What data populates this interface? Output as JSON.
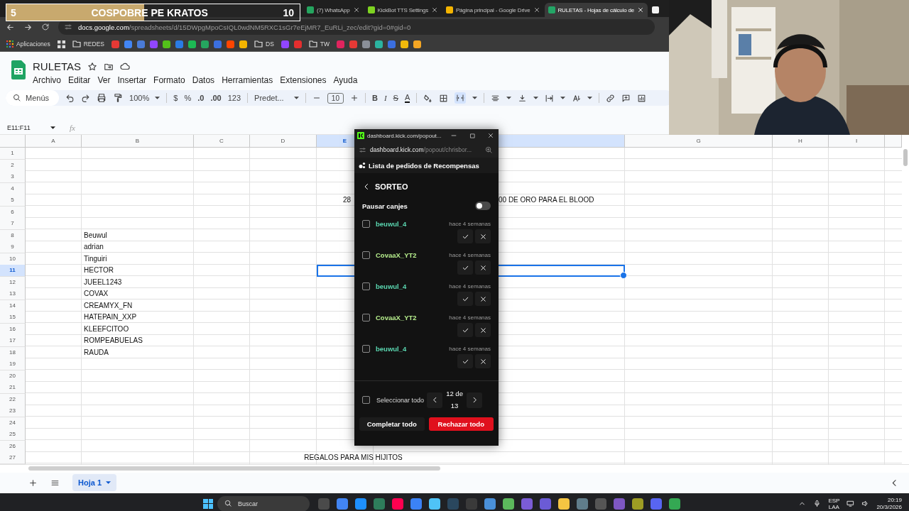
{
  "stream_overlay": {
    "start": "5",
    "title": "COSPOBRE PE KRATOS",
    "target": "10",
    "level": 0.47
  },
  "browser": {
    "tabs": [
      {
        "title": "(7) WhatsApp",
        "color": "#25a55f",
        "selected": false
      },
      {
        "title": "KickBot TTS Settings",
        "color": "#7ed321",
        "selected": false
      },
      {
        "title": "Página principal - Google Drive",
        "color": "#f4b400",
        "selected": false
      },
      {
        "title": "RULETAS - Hojas de cálculo de",
        "color": "#23a566",
        "selected": true
      },
      {
        "color": "#f2f2f2",
        "selected": false
      }
    ],
    "url_host": "docs.google.com",
    "url_path": "/spreadsheets/d/15DWpgMpoCsIQL0wdNM5RXC1sGr7eEjMR7_EuRLi_zec/edit?gid=0#gid=0",
    "bookmarks": [
      {
        "kind": "apps",
        "label": "Aplicaciones"
      },
      {
        "kind": "folder",
        "label": "REDES"
      },
      {
        "kind": "site",
        "color": "#e53935"
      },
      {
        "kind": "site",
        "color": "#4285f4"
      },
      {
        "kind": "site",
        "color": "#4a7bd8"
      },
      {
        "kind": "site",
        "color": "#9146ff"
      },
      {
        "kind": "site",
        "color": "#53c01a"
      },
      {
        "kind": "site",
        "color": "#2a7be4"
      },
      {
        "kind": "site",
        "color": "#1db954"
      },
      {
        "kind": "site",
        "color": "#25a55f"
      },
      {
        "kind": "site",
        "color": "#3b6fe0"
      },
      {
        "kind": "site",
        "color": "#ff4500"
      },
      {
        "kind": "site",
        "color": "#f4b400"
      },
      {
        "kind": "folder",
        "label": "DS"
      },
      {
        "kind": "site",
        "color": "#9146ff"
      },
      {
        "kind": "site",
        "color": "#e52e2e"
      },
      {
        "kind": "folder",
        "label": "TW"
      },
      {
        "kind": "site",
        "color": "#e0245e"
      },
      {
        "kind": "site",
        "color": "#e53935"
      },
      {
        "kind": "site",
        "color": "#8a8f98"
      },
      {
        "kind": "site",
        "color": "#2bb3a0"
      },
      {
        "kind": "site",
        "color": "#3b6fe0"
      },
      {
        "kind": "site",
        "color": "#f0b90b"
      },
      {
        "kind": "site",
        "color": "#f5a623"
      }
    ]
  },
  "doc": {
    "title": "RULETAS",
    "menu": [
      "Archivo",
      "Editar",
      "Ver",
      "Insertar",
      "Formato",
      "Datos",
      "Herramientas",
      "Extensiones",
      "Ayuda"
    ],
    "toolbar": {
      "search": "Menús",
      "zoom": "100%",
      "currency": "$",
      "percent": "%",
      "decrease_decimals": ".0",
      "increase_decimals": ".00",
      "number_format": "123",
      "font": "Predet...",
      "font_size": "10",
      "bold": "B",
      "italic": "I",
      "strikethrough": "S",
      "text_color": "A",
      "merge_selected": true
    },
    "name_box": "E11:F11",
    "formula_icon": "fx"
  },
  "sheet": {
    "columns": [
      {
        "label": "A",
        "selected": false
      },
      {
        "label": "B",
        "selected": false
      },
      {
        "label": "C",
        "selected": false
      },
      {
        "label": "D",
        "selected": false
      },
      {
        "label": "E",
        "selected": true
      },
      {
        "selected": true
      },
      {
        "label": "G",
        "selected": false
      },
      {
        "label": "H",
        "selected": false
      },
      {
        "label": "I",
        "selected": false
      }
    ],
    "rows": [
      {
        "number": "1",
        "selected": false
      },
      {
        "number": "2",
        "selected": false
      },
      {
        "number": "3",
        "selected": false
      },
      {
        "number": "4",
        "selected": false
      },
      {
        "number": "5",
        "selected": false,
        "e": "28",
        "f": "00 DE ORO PARA EL BLOOD"
      },
      {
        "number": "6",
        "selected": false
      },
      {
        "number": "7",
        "selected": false
      },
      {
        "number": "8",
        "selected": false,
        "b": "Beuwul"
      },
      {
        "number": "9",
        "selected": false,
        "b": "adrian"
      },
      {
        "number": "10",
        "selected": false,
        "b": "Tinguiri"
      },
      {
        "number": "11",
        "selected": true,
        "b": "HECTOR"
      },
      {
        "number": "12",
        "selected": false,
        "b": "JUEEL1243"
      },
      {
        "number": "13",
        "selected": false,
        "b": "COVAX"
      },
      {
        "number": "14",
        "selected": false,
        "b": "CREAMYX_FN"
      },
      {
        "number": "15",
        "selected": false,
        "b": "HATEPAIN_XXP"
      },
      {
        "number": "16",
        "selected": false,
        "b": "KLEEFCITOO"
      },
      {
        "number": "17",
        "selected": false,
        "b": "ROMPEABUELAS"
      },
      {
        "number": "18",
        "selected": false,
        "b": "RAUDA"
      },
      {
        "number": "19",
        "selected": false
      },
      {
        "number": "20",
        "selected": false
      },
      {
        "number": "21",
        "selected": false
      },
      {
        "number": "22",
        "selected": false
      },
      {
        "number": "23",
        "selected": false
      },
      {
        "number": "24",
        "selected": false
      },
      {
        "number": "25",
        "selected": false
      },
      {
        "number": "26",
        "selected": false
      },
      {
        "number": "27",
        "selected": false,
        "merged": "REGALOS PARA MIS HIJITOS"
      }
    ],
    "tabs": [
      {
        "label": "Hoja 1",
        "selected": true
      }
    ]
  },
  "popup": {
    "title": "dashboard.kick.com/popout...",
    "url_host": "dashboard.kick.com",
    "url_path": "/popout/chrisbor...",
    "heading": "Lista de pedidos de Recompensas",
    "section": "SORTEO",
    "pause_label": "Pausar canjes",
    "pause_on": false,
    "requests": [
      {
        "user": "beuwul_4",
        "color": "#5ad6b0",
        "time": "hace 4 semanas",
        "checked": false
      },
      {
        "user": "CovaaX_YT2",
        "color": "#b8f08e",
        "time": "hace 4 semanas",
        "checked": false
      },
      {
        "user": "beuwul_4",
        "color": "#5ad6b0",
        "time": "hace 4 semanas",
        "checked": false
      },
      {
        "user": "CovaaX_YT2",
        "color": "#b8f08e",
        "time": "hace 4 semanas",
        "checked": false
      },
      {
        "user": "beuwul_4",
        "color": "#5ad6b0",
        "time": "hace 4 semanas",
        "checked": false
      }
    ],
    "select_all": {
      "label": "Seleccionar todo",
      "checked": false
    },
    "page": "12 de 13",
    "buttons": [
      {
        "label": "Completar todo",
        "kind": "secondary"
      },
      {
        "label": "Rechazar todo",
        "kind": "danger"
      }
    ]
  },
  "taskbar": {
    "search": "Buscar",
    "apps": [
      {
        "color": "#4a4a4a"
      },
      {
        "color": "#4285f4"
      },
      {
        "color": "#1e90ff"
      },
      {
        "color": "#2e7d5b"
      },
      {
        "color": "#ff0050"
      },
      {
        "color": "#3b82f6"
      },
      {
        "color": "#4fc3f7"
      },
      {
        "color": "#2a475e"
      },
      {
        "color": "#3a3a3a"
      },
      {
        "color": "#4a90d9"
      },
      {
        "color": "#5cb85c"
      },
      {
        "color": "#7b5cd6"
      },
      {
        "color": "#6b5bd6"
      },
      {
        "color": "#f5c542"
      },
      {
        "color": "#607d8b"
      },
      {
        "color": "#555555"
      },
      {
        "color": "#7e57c2"
      },
      {
        "color": "#9e9d24"
      },
      {
        "color": "#5865f2"
      },
      {
        "color": "#34a853"
      }
    ],
    "language": "ESP",
    "layout": "LAA",
    "time": "20:19",
    "date": "20/3/2026"
  }
}
